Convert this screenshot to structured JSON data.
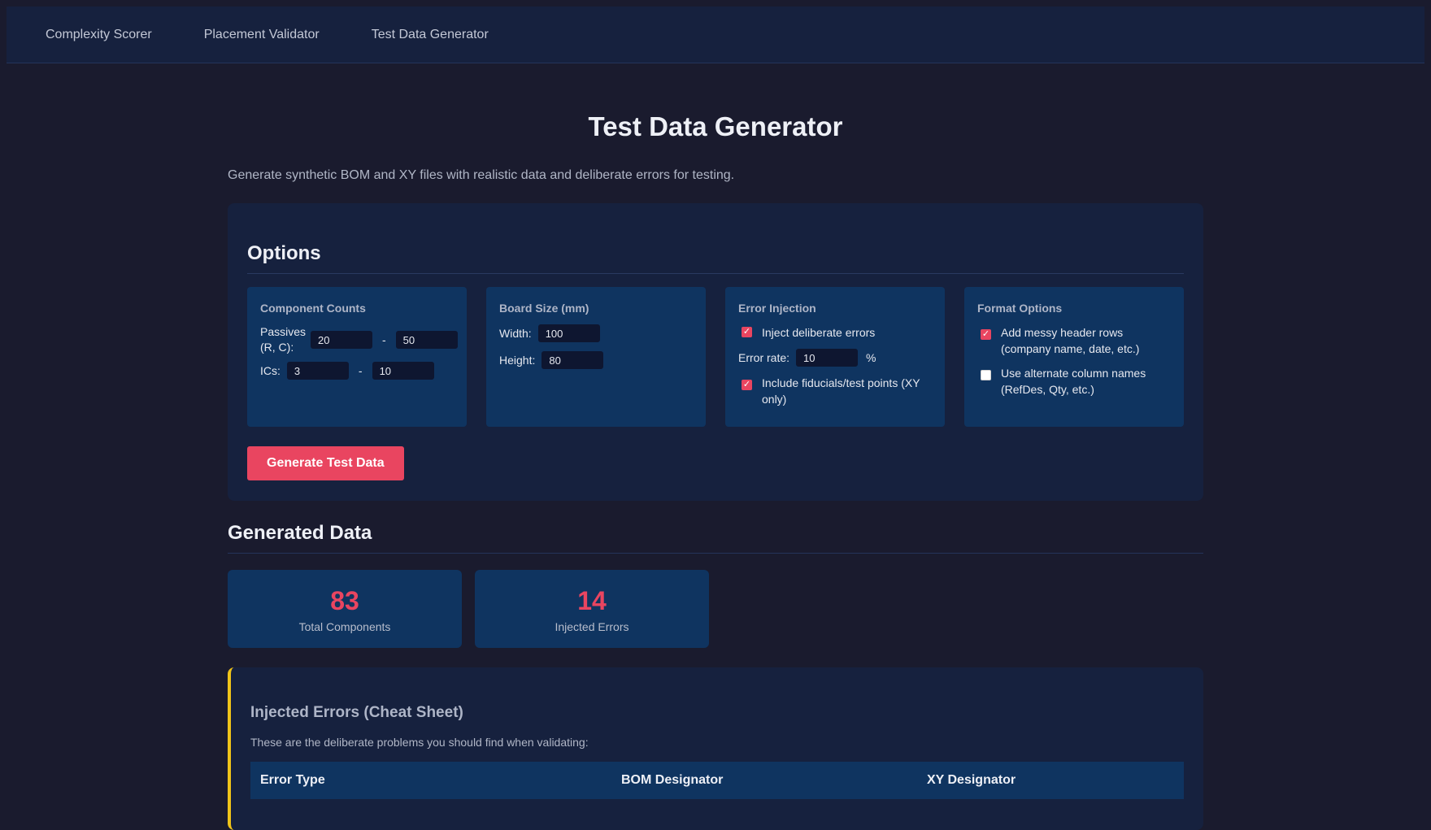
{
  "nav": {
    "items": [
      {
        "label": "Complexity Scorer"
      },
      {
        "label": "Placement Validator"
      },
      {
        "label": "Test Data Generator"
      }
    ]
  },
  "page": {
    "title": "Test Data Generator",
    "subtitle": "Generate synthetic BOM and XY files with realistic data and deliberate errors for testing."
  },
  "options": {
    "heading": "Options",
    "component_counts": {
      "title": "Component Counts",
      "passives_label": "Passives (R, C):",
      "passives_min": "20",
      "passives_max": "50",
      "ics_label": "ICs:",
      "ics_min": "3",
      "ics_max": "10",
      "dash": "-"
    },
    "board_size": {
      "title": "Board Size (mm)",
      "width_label": "Width:",
      "width_value": "100",
      "height_label": "Height:",
      "height_value": "80"
    },
    "error_injection": {
      "title": "Error Injection",
      "inject_label": "Inject deliberate errors",
      "inject_checked": true,
      "rate_label": "Error rate:",
      "rate_value": "10",
      "rate_unit": "%",
      "fiducials_label": "Include fiducials/test points (XY only)",
      "fiducials_checked": true
    },
    "format_options": {
      "title": "Format Options",
      "messy_label": "Add messy header rows (company name, date, etc.)",
      "messy_checked": true,
      "alt_label": "Use alternate column names (RefDes, Qty, etc.)",
      "alt_checked": false
    },
    "generate_label": "Generate Test Data"
  },
  "generated": {
    "heading": "Generated Data",
    "stats": [
      {
        "value": "83",
        "label": "Total Components"
      },
      {
        "value": "14",
        "label": "Injected Errors"
      }
    ]
  },
  "cheat_sheet": {
    "title": "Injected Errors (Cheat Sheet)",
    "description": "These are the deliberate problems you should find when validating:",
    "columns": [
      "Error Type",
      "BOM Designator",
      "XY Designator"
    ]
  },
  "colors": {
    "accent": "#e94560",
    "warning_border": "#f0c419",
    "background": "#1a1b2e",
    "panel": "#16213e",
    "card": "#0f3460"
  }
}
